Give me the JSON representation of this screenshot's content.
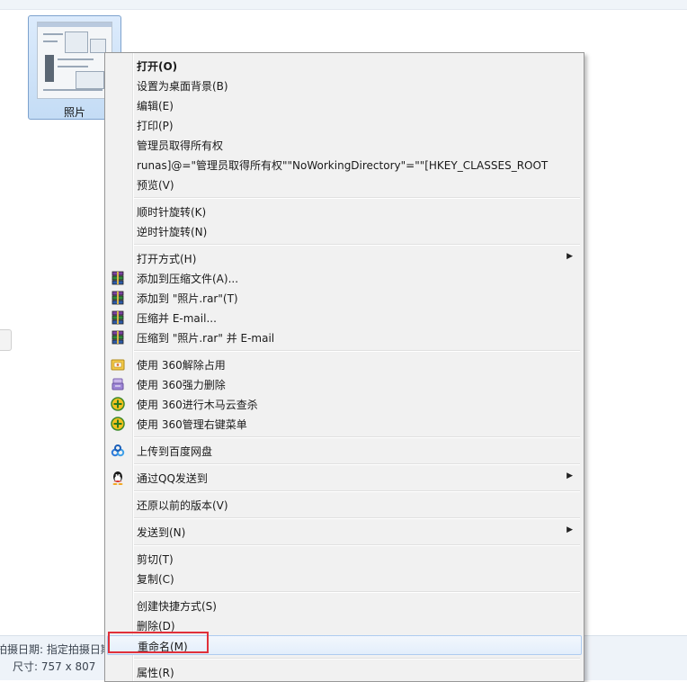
{
  "file": {
    "name": "照片"
  },
  "status": {
    "taken_date": "拍摄日期: 指定拍摄日期",
    "dimensions": "尺寸: 757 x 807"
  },
  "menu": {
    "groups": [
      [
        {
          "label": "打开(O)",
          "bold": true
        },
        {
          "label": "设置为桌面背景(B)"
        },
        {
          "label": "编辑(E)"
        },
        {
          "label": "打印(P)"
        },
        {
          "label": "管理员取得所有权"
        },
        {
          "label": "runas]@=\"管理员取得所有权\"\"NoWorkingDirectory\"=\"\"[HKEY_CLASSES_ROOT"
        },
        {
          "label": "预览(V)"
        }
      ],
      [
        {
          "label": "顺时针旋转(K)"
        },
        {
          "label": "逆时针旋转(N)"
        }
      ],
      [
        {
          "label": "打开方式(H)",
          "submenu": true
        },
        {
          "label": "添加到压缩文件(A)...",
          "icon": "winrar-icon"
        },
        {
          "label": "添加到 \"照片.rar\"(T)",
          "icon": "winrar-icon"
        },
        {
          "label": "压缩并 E-mail...",
          "icon": "winrar-icon"
        },
        {
          "label": "压缩到 \"照片.rar\" 并 E-mail",
          "icon": "winrar-icon"
        }
      ],
      [
        {
          "label": "使用 360解除占用",
          "icon": "360-unlock-icon"
        },
        {
          "label": "使用 360强力删除",
          "icon": "360-shred-icon"
        },
        {
          "label": "使用 360进行木马云查杀",
          "icon": "360-scan-icon"
        },
        {
          "label": "使用 360管理右键菜单",
          "icon": "360-menu-icon"
        }
      ],
      [
        {
          "label": "上传到百度网盘",
          "icon": "baidu-netdisk-icon"
        }
      ],
      [
        {
          "label": "通过QQ发送到",
          "icon": "qq-icon",
          "submenu": true
        }
      ],
      [
        {
          "label": "还原以前的版本(V)"
        }
      ],
      [
        {
          "label": "发送到(N)",
          "submenu": true
        }
      ],
      [
        {
          "label": "剪切(T)"
        },
        {
          "label": "复制(C)"
        }
      ],
      [
        {
          "label": "创建快捷方式(S)"
        },
        {
          "label": "删除(D)"
        },
        {
          "label": "重命名(M)",
          "highlighted": true
        }
      ],
      [
        {
          "label": "属性(R)"
        }
      ]
    ]
  },
  "colors": {
    "highlight_border": "#aecbf0",
    "annotation_red": "#e0303a",
    "selection_blue": "#c4dcf5"
  }
}
